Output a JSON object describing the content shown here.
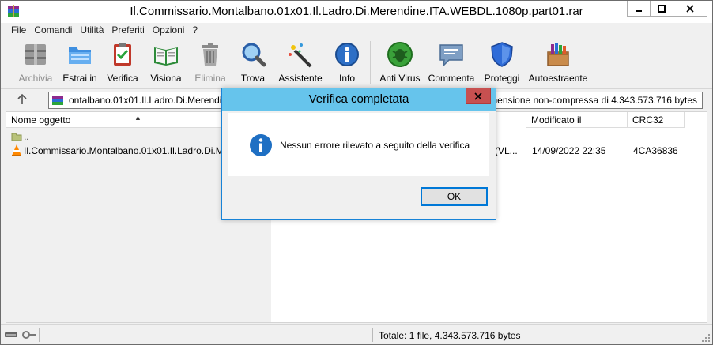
{
  "window": {
    "title": "Il.Commissario.Montalbano.01x01.Il.Ladro.Di.Merendine.ITA.WEBDL.1080p.part01.rar"
  },
  "menu": [
    "File",
    "Comandi",
    "Utilità",
    "Preferiti",
    "Opzioni",
    "?"
  ],
  "toolbar": [
    {
      "label": "Archivia",
      "icon": "archive-icon",
      "enabled": false
    },
    {
      "label": "Estrai in",
      "icon": "extract-folder-icon",
      "enabled": true
    },
    {
      "label": "Verifica",
      "icon": "test-clipboard-icon",
      "enabled": true
    },
    {
      "label": "Visiona",
      "icon": "view-book-icon",
      "enabled": true
    },
    {
      "label": "Elimina",
      "icon": "trash-icon",
      "enabled": false
    },
    {
      "label": "Trova",
      "icon": "magnifier-icon",
      "enabled": true
    },
    {
      "label": "Assistente",
      "icon": "wizard-wand-icon",
      "enabled": true
    },
    {
      "label": "Info",
      "icon": "info-icon",
      "enabled": true
    },
    {
      "label": "Anti Virus",
      "icon": "antivirus-bug-icon",
      "enabled": true
    },
    {
      "label": "Commenta",
      "icon": "comment-icon",
      "enabled": true
    },
    {
      "label": "Proteggi",
      "icon": "shield-icon",
      "enabled": true
    },
    {
      "label": "Autoestraente",
      "icon": "sfx-box-icon",
      "enabled": true
    }
  ],
  "address": {
    "path": "ontalbano.01x01.Il.Ladro.Di.Merendine",
    "info": "nensione non-compressa di 4.343.573.716 bytes"
  },
  "columns": {
    "name": "Nome oggetto",
    "modified": "Modificato il",
    "crc": "CRC32"
  },
  "files": [
    {
      "name": "..",
      "type_frag": "",
      "modified": "",
      "crc": ""
    },
    {
      "name": "Il.Commissario.Montalbano.01x01.Il.Ladro.Di.M",
      "type_frag": "(VL...",
      "modified": "14/09/2022 22:35",
      "crc": "4CA36836"
    }
  ],
  "status": {
    "total": "Totale: 1 file, 4.343.573.716 bytes"
  },
  "dialog": {
    "title": "Verifica completata",
    "message": "Nessun errore rilevato a seguito della verifica",
    "ok": "OK"
  },
  "colors": {
    "dialog_title_bg": "#66c4ec",
    "close_red": "#c75050",
    "info_blue": "#1e6fc3",
    "ok_border": "#0078d7"
  }
}
